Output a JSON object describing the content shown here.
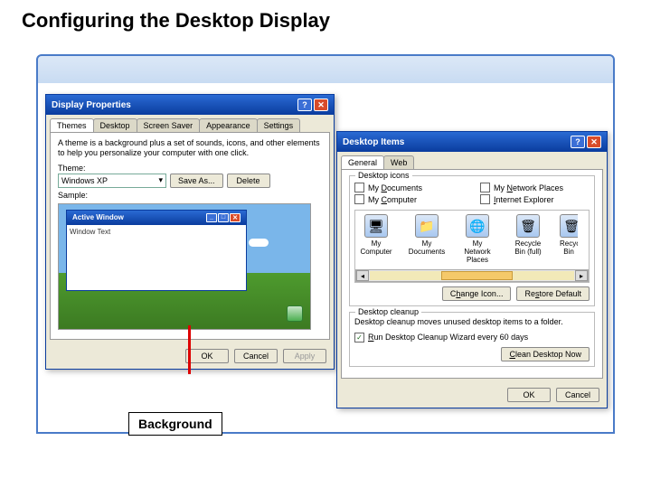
{
  "page_title": "Configuring the Desktop Display",
  "callout": "Background",
  "display_properties": {
    "title": "Display Properties",
    "tabs": [
      "Themes",
      "Desktop",
      "Screen Saver",
      "Appearance",
      "Settings"
    ],
    "active_tab_index": 0,
    "description": "A theme is a background plus a set of sounds, icons, and other elements to help you personalize your computer with one click.",
    "theme_label": "Theme:",
    "theme_selected": "Windows XP",
    "save_as": "Save As...",
    "delete": "Delete",
    "sample_label": "Sample:",
    "preview_window_title": "Active Window",
    "preview_window_text": "Window Text",
    "ok": "OK",
    "cancel": "Cancel",
    "apply": "Apply"
  },
  "desktop_items": {
    "title": "Desktop Items",
    "tabs": [
      "General",
      "Web"
    ],
    "active_tab_index": 0,
    "group_icons": "Desktop icons",
    "chk_my_documents": "My Documents",
    "chk_my_computer": "My Computer",
    "chk_my_network": "My Network Places",
    "chk_internet_explorer": "Internet Explorer",
    "icons": [
      "My Computer",
      "My Documents",
      "My Network Places",
      "Recycle Bin (full)",
      "Recycle Bin"
    ],
    "change_icon": "Change Icon...",
    "restore_default": "Restore Default",
    "group_cleanup": "Desktop cleanup",
    "cleanup_desc": "Desktop cleanup moves unused desktop items to a folder.",
    "chk_run_wizard": "Run Desktop Cleanup Wizard every 60 days",
    "clean_now": "Clean Desktop Now",
    "ok": "OK",
    "cancel": "Cancel"
  }
}
